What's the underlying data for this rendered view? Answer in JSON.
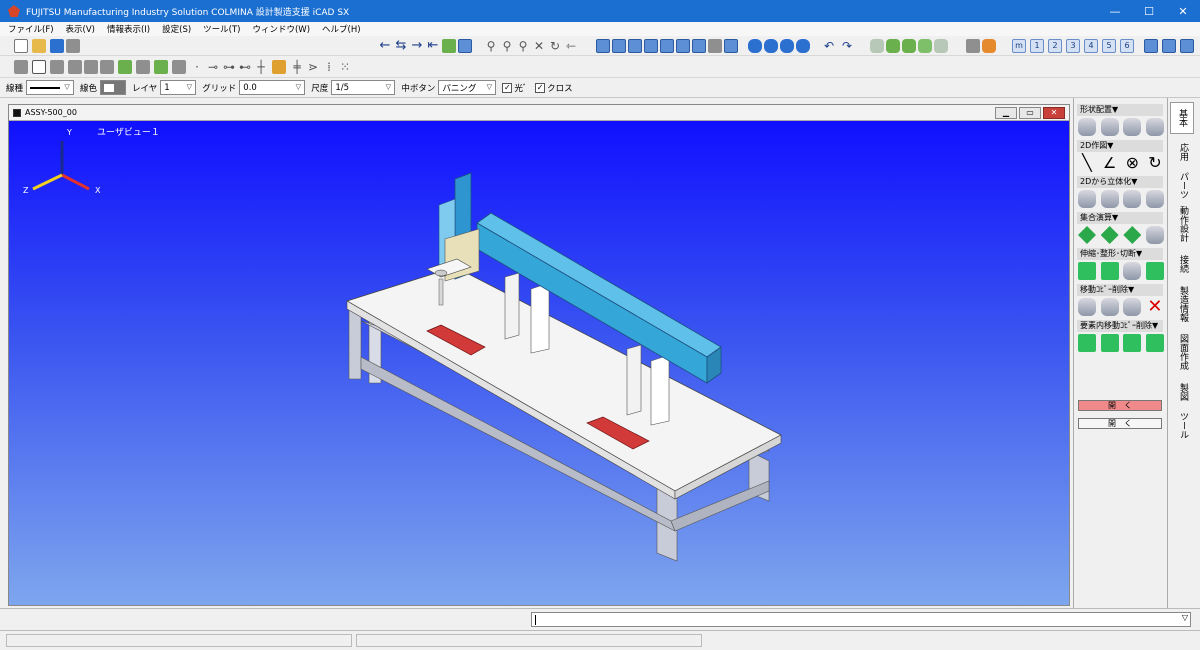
{
  "window": {
    "title": "FUJITSU Manufacturing Industry Solution COLMINA 設計製造支援 iCAD SX",
    "minimize": "—",
    "maximize": "☐",
    "close": "✕"
  },
  "menu": [
    "ファイル(F)",
    "表示(V)",
    "情報表示(I)",
    "設定(S)",
    "ツール(T)",
    "ウィンドウ(W)",
    "ヘルプ(H)"
  ],
  "props": {
    "line_type_label": "線種",
    "line_color_label": "線色",
    "layer_label": "レイヤ",
    "layer_value": "1",
    "grid_label": "グリッド",
    "grid_value": "0.0",
    "scale_label": "尺度",
    "scale_value": "1/5",
    "mid_button_label": "中ボタン",
    "mid_button_value": "パニング",
    "check_light": "光ﾞ",
    "check_cross": "クロス"
  },
  "document": {
    "name": "ASSY-500_00",
    "view_label": "ユーザビュー１",
    "axis": {
      "x": "X",
      "y": "Y",
      "z": "Z"
    }
  },
  "toolbar_numbers": [
    "m",
    "1",
    "2",
    "3",
    "4",
    "5",
    "6"
  ],
  "panel": {
    "sections": [
      "形状配置▼",
      "2D作図▼",
      "2Dから立体化▼",
      "集合演算▼",
      "伸縮･整形･切断▼",
      "移動ｺﾋﾟｰ削除▼",
      "要素内移動ｺﾋﾟｰ削除▼"
    ],
    "open_button_1": "開　く",
    "open_button_2": "開　く"
  },
  "tabs": [
    "基本",
    "応用",
    "パーツ",
    "動作設計",
    "接続",
    "製造情報",
    "図面作成",
    "製図",
    "ツール"
  ],
  "colors": {
    "titlebar": "#1b6fd1",
    "viewport_top": "#1010ff",
    "viewport_bottom": "#7ea6ee",
    "rail": "#35a6d8"
  }
}
